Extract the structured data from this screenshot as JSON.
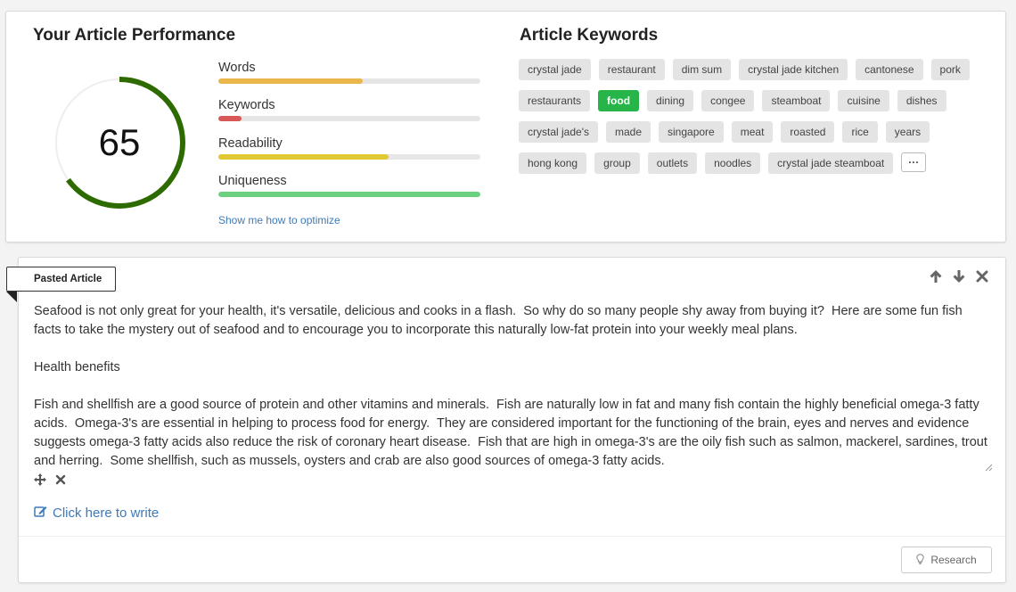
{
  "performance": {
    "title": "Your Article Performance",
    "score": "65",
    "score_fraction": 0.65,
    "gauge_color": "#2d6b00",
    "metrics": [
      {
        "label": "Words",
        "fill": 0.55,
        "color": "#e8b64a"
      },
      {
        "label": "Keywords",
        "fill": 0.09,
        "color": "#d95757"
      },
      {
        "label": "Readability",
        "fill": 0.65,
        "color": "#e2c832"
      },
      {
        "label": "Uniqueness",
        "fill": 1.0,
        "color": "#6bd17f"
      }
    ],
    "optimize_link": "Show me how to optimize"
  },
  "keywords": {
    "title": "Article Keywords",
    "items": [
      "crystal jade",
      "restaurant",
      "dim sum",
      "crystal jade kitchen",
      "cantonese",
      "pork",
      "restaurants",
      "food",
      "dining",
      "congee",
      "steamboat",
      "cuisine",
      "dishes",
      "crystal jade's",
      "made",
      "singapore",
      "meat",
      "roasted",
      "rice",
      "years",
      "hong kong",
      "group",
      "outlets",
      "noodles",
      "crystal jade steamboat"
    ],
    "active": "food",
    "more_label": "···"
  },
  "article": {
    "tab_label": "Pasted Article",
    "text": "Seafood is not only great for your health, it's versatile, delicious and cooks in a flash.  So why do so many people shy away from buying it?  Here are some fun fish facts to take the mystery out of seafood and to encourage you to incorporate this naturally low-fat protein into your weekly meal plans.\n\nHealth benefits\n\nFish and shellfish are a good source of protein and other vitamins and minerals.  Fish are naturally low in fat and many fish contain the highly beneficial omega-3 fatty acids.  Omega-3's are essential in helping to process food for energy.  They are considered important for the functioning of the brain, eyes and nerves and evidence suggests omega-3 fatty acids also reduce the risk of coronary heart disease.  Fish that are high in omega-3's are the oily fish such as salmon, mackerel, sardines, trout and herring.  Some shellfish, such as mussels, oysters and crab are also good sources of omega-3 fatty acids.",
    "write_link": "Click here to write",
    "research_button": "Research"
  }
}
